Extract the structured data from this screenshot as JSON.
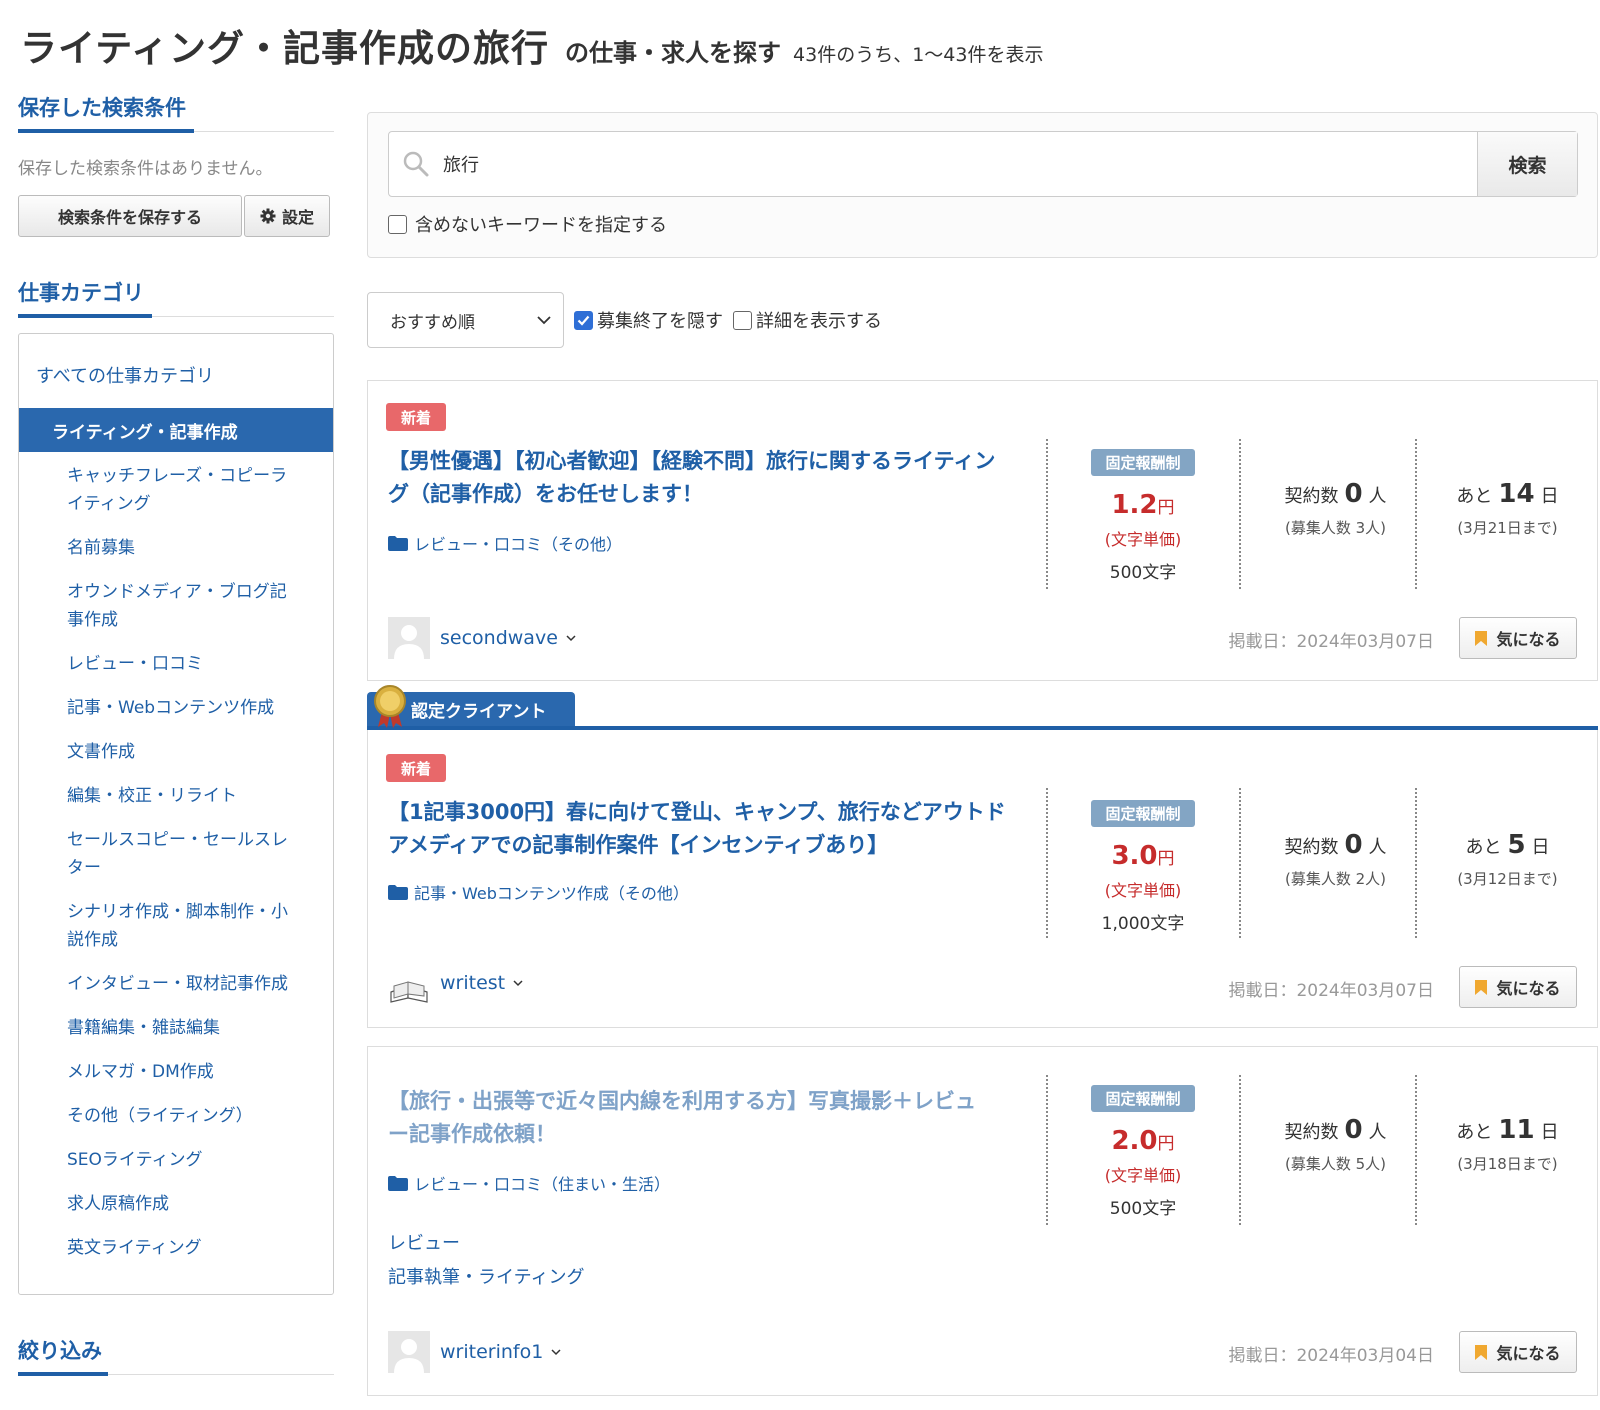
{
  "header": {
    "title": "ライティング・記事作成の旅行",
    "subtitle": "の仕事・求人を探す",
    "count": "43件のうち、1〜43件を表示"
  },
  "sidebar": {
    "saved_heading": "保存した検索条件",
    "saved_empty": "保存した検索条件はありません。",
    "save_button": "検索条件を保存する",
    "settings_button": "設定",
    "category_heading": "仕事カテゴリ",
    "all_categories": "すべての仕事カテゴリ",
    "selected_category": "ライティング・記事作成",
    "categories": [
      "キャッチフレーズ・コピーライティング",
      "名前募集",
      "オウンドメディア・ブログ記事作成",
      "レビュー・口コミ",
      "記事・Webコンテンツ作成",
      "文書作成",
      "編集・校正・リライト",
      "セールスコピー・セールスレター",
      "シナリオ作成・脚本制作・小説作成",
      "インタビュー・取材記事作成",
      "書籍編集・雑誌編集",
      "メルマガ・DM作成",
      "その他（ライティング）",
      "SEOライティング",
      "求人原稿作成",
      "英文ライティング"
    ],
    "filter_heading": "絞り込み"
  },
  "search": {
    "value": "旅行",
    "button": "検索",
    "exclude_label": "含めないキーワードを指定する",
    "exclude_checked": false
  },
  "sortbar": {
    "sort_selected": "おすすめ順",
    "hide_closed_label": "募集終了を隠す",
    "hide_closed_checked": true,
    "show_detail_label": "詳細を表示する",
    "show_detail_checked": false
  },
  "verified_label": "認定クライアント",
  "jobs": [
    {
      "badge": "新着",
      "title": "【男性優遇】【初心者歓迎】【経験不問】旅行に関するライティング（記事作成）をお任せします！",
      "category": "レビュー・口コミ（その他）",
      "pay_type": "固定報酬制",
      "pay_amount": "1.2",
      "pay_unit": "円",
      "pay_note": "(文字単価)",
      "pay_chars": "500文字",
      "contracts_prefix": "契約数",
      "contracts": "0",
      "contracts_unit": "人",
      "recruit": "(募集人数 3人)",
      "remain_prefix": "あと",
      "remain_days": "14",
      "remain_unit": "日",
      "deadline": "(3月21日まで)",
      "user": "secondwave",
      "posted": "掲載日：2024年03月07日",
      "fav": "気になる"
    },
    {
      "badge": "新着",
      "title": "【1記事3000円】春に向けて登山、キャンプ、旅行などアウトドアメディアでの記事制作案件【インセンティブあり】",
      "category": "記事・Webコンテンツ作成（その他）",
      "pay_type": "固定報酬制",
      "pay_amount": "3.0",
      "pay_unit": "円",
      "pay_note": "(文字単価)",
      "pay_chars": "1,000文字",
      "contracts_prefix": "契約数",
      "contracts": "0",
      "contracts_unit": "人",
      "recruit": "(募集人数 2人)",
      "remain_prefix": "あと",
      "remain_days": "5",
      "remain_unit": "日",
      "deadline": "(3月12日まで)",
      "user": "writest",
      "posted": "掲載日：2024年03月07日",
      "fav": "気になる"
    },
    {
      "title": "【旅行・出張等で近々国内線を利用する方】写真撮影＋レビュー記事作成依頼！",
      "category": "レビュー・口コミ（住まい・生活）",
      "pay_type": "固定報酬制",
      "pay_amount": "2.0",
      "pay_unit": "円",
      "pay_note": "(文字単価)",
      "pay_chars": "500文字",
      "contracts_prefix": "契約数",
      "contracts": "0",
      "contracts_unit": "人",
      "recruit": "(募集人数 5人)",
      "remain_prefix": "あと",
      "remain_days": "11",
      "remain_unit": "日",
      "deadline": "(3月18日まで)",
      "tags": [
        "レビュー",
        "記事執筆・ライティング"
      ],
      "user": "writerinfo1",
      "posted": "掲載日：2024年03月04日",
      "fav": "気になる"
    }
  ],
  "colors": {
    "brand_blue": "#1f5fa6",
    "new_badge": "#e8686a",
    "price_red": "#c62c2c",
    "pay_badge": "#83a5c4"
  }
}
